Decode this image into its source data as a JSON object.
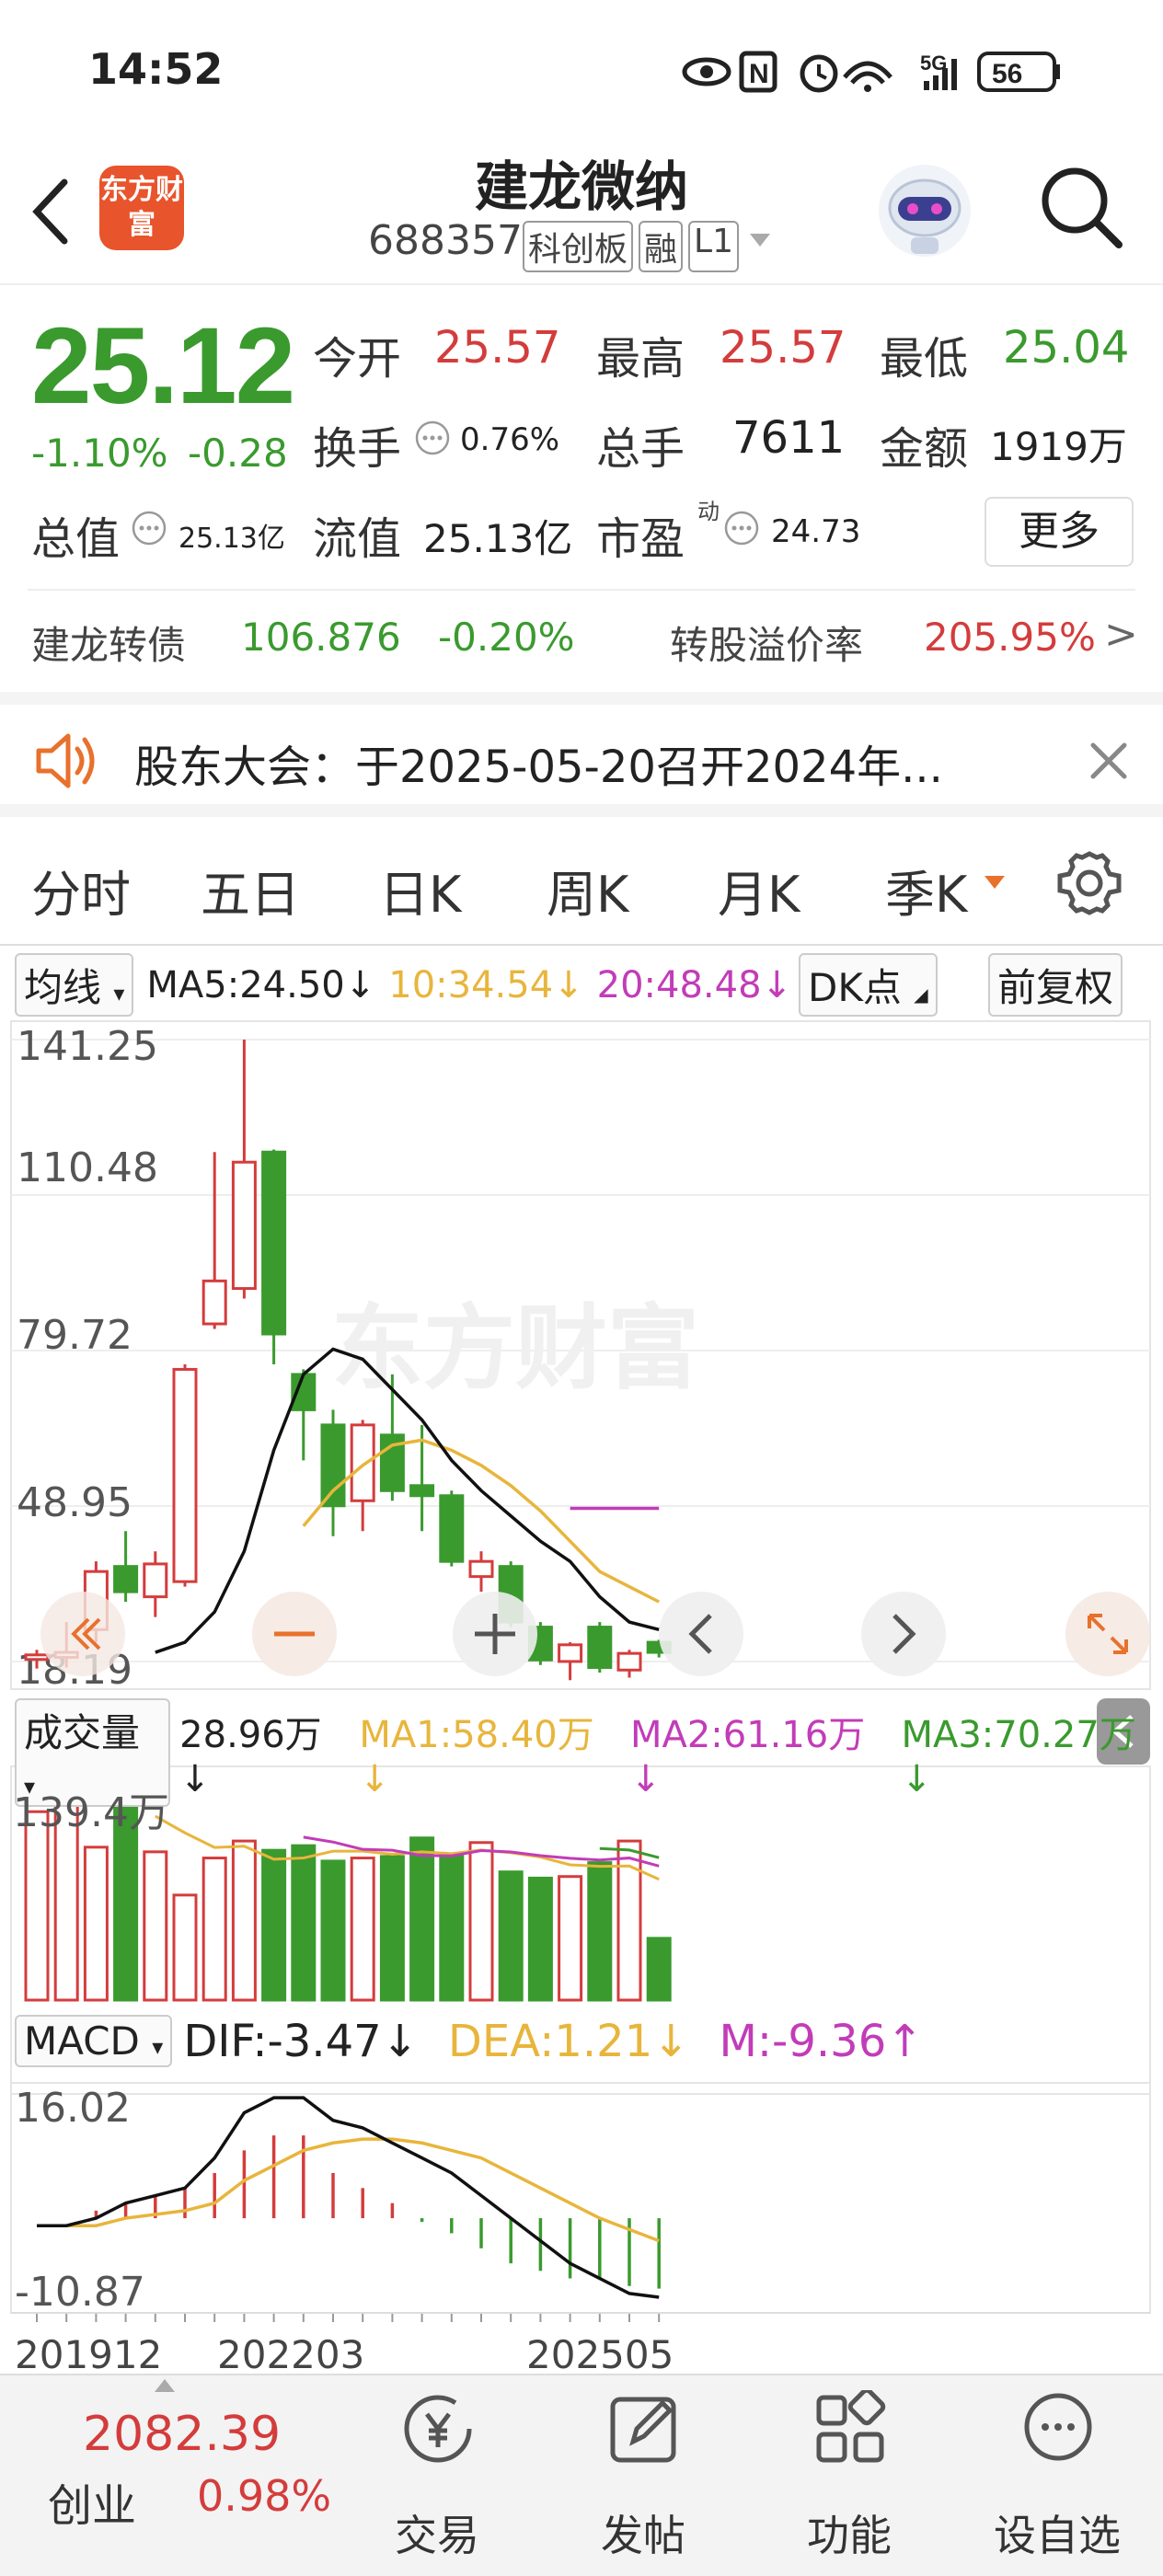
{
  "status": {
    "time": "14:52",
    "network": "5G",
    "battery": "56"
  },
  "header": {
    "logo_text": "东方财富",
    "title": "建龙微纳",
    "code": "688357",
    "tags": [
      "科创板",
      "融",
      "L1"
    ]
  },
  "quote": {
    "price": "25.12",
    "change_pct": "-1.10%",
    "change": "-0.28",
    "open_label": "今开",
    "open": "25.57",
    "high_label": "最高",
    "high": "25.57",
    "low_label": "最低",
    "low": "25.04",
    "turnover_label": "换手",
    "turnover": "0.76%",
    "volume_label": "总手",
    "volume": "7611",
    "amount_label": "金额",
    "amount": "1919万",
    "mktcap_label": "总值",
    "mktcap": "25.13亿",
    "float_label": "流值",
    "float_cap": "25.13亿",
    "pe_label": "市盈",
    "pe_sup": "动",
    "pe": "24.73",
    "more": "更多"
  },
  "bond": {
    "name": "建龙转债",
    "price": "106.876",
    "change": "-0.20%",
    "premium_label": "转股溢价率",
    "premium": "205.95%",
    "arrow": ">"
  },
  "notice": {
    "text": "股东大会：于2025-05-20召开2024年..."
  },
  "tabs": [
    "分时",
    "五日",
    "日K",
    "周K",
    "月K",
    "季K"
  ],
  "active_tab": "季K",
  "ma_bar": {
    "dropdown": "均线",
    "ma5": "MA5:24.50↓",
    "ma10": "10:34.54↓",
    "ma20": "20:48.48↓",
    "dk": "DK点",
    "adjust": "前复权"
  },
  "price_axis": [
    "141.25",
    "110.48",
    "79.72",
    "48.95",
    "18.19"
  ],
  "watermark": "东方财富",
  "vol_bar": {
    "dropdown": "成交量",
    "vol": "28.96万↓",
    "ma1": "MA1:58.40万↓",
    "ma2": "MA2:61.16万↓",
    "ma3": "MA3:70.27万↓",
    "axis_top": "139.4万"
  },
  "macd_bar": {
    "dropdown": "MACD",
    "dif": "DIF:-3.47↓",
    "dea": "DEA:1.21↓",
    "m": "M:-9.36↑",
    "axis_top": "16.02",
    "axis_bottom": "-10.87"
  },
  "date_axis": [
    "201912",
    "202203",
    "202505"
  ],
  "bottom_nav": {
    "index_value": "2082.39",
    "index_name": "创业",
    "index_change": "0.98%",
    "items": [
      "交易",
      "发帖",
      "功能",
      "设自选"
    ]
  },
  "colors": {
    "up": "#d43c3c",
    "down": "#3a9a2e",
    "accent": "#e8712c",
    "ma10": "#e8b53c",
    "ma20": "#c23cb8"
  },
  "chart_data": {
    "type": "candlestick",
    "period": "quarterly",
    "candles": [
      {
        "o": 18.6,
        "c": 19.5,
        "h": 20.5,
        "l": 16.8
      },
      {
        "o": 19.0,
        "c": 20.0,
        "h": 26.0,
        "l": 17.0
      },
      {
        "o": 24.5,
        "c": 36.0,
        "h": 38.0,
        "l": 22.0
      },
      {
        "o": 37.0,
        "c": 32.0,
        "h": 44.0,
        "l": 30.0
      },
      {
        "o": 31.0,
        "c": 37.5,
        "h": 40.0,
        "l": 27.0
      },
      {
        "o": 34.0,
        "c": 76.0,
        "h": 77.0,
        "l": 33.0
      },
      {
        "o": 85.0,
        "c": 93.5,
        "h": 119.0,
        "l": 84.0
      },
      {
        "o": 92.0,
        "c": 117.0,
        "h": 141.25,
        "l": 90.0
      },
      {
        "o": 119.0,
        "c": 83.0,
        "h": 119.5,
        "l": 77.0
      },
      {
        "o": 75.0,
        "c": 68.0,
        "h": 76.0,
        "l": 58.0
      },
      {
        "o": 65.0,
        "c": 49.0,
        "h": 68.0,
        "l": 43.0
      },
      {
        "o": 50.0,
        "c": 65.0,
        "h": 66.0,
        "l": 44.0
      },
      {
        "o": 63.0,
        "c": 52.0,
        "h": 75.0,
        "l": 50.0
      },
      {
        "o": 53.0,
        "c": 51.0,
        "h": 65.0,
        "l": 44.0
      },
      {
        "o": 51.0,
        "c": 38.0,
        "h": 52.0,
        "l": 37.0
      },
      {
        "o": 35.0,
        "c": 38.0,
        "h": 40.0,
        "l": 32.0
      },
      {
        "o": 37.0,
        "c": 26.0,
        "h": 38.0,
        "l": 25.0
      },
      {
        "o": 25.0,
        "c": 18.5,
        "h": 26.0,
        "l": 17.5
      },
      {
        "o": 18.2,
        "c": 21.5,
        "h": 22.0,
        "l": 14.5
      },
      {
        "o": 25.0,
        "c": 17.0,
        "h": 26.0,
        "l": 16.0
      },
      {
        "o": 16.5,
        "c": 19.8,
        "h": 20.5,
        "l": 15.0
      },
      {
        "o": 22.0,
        "c": 20.0,
        "h": 22.5,
        "l": 19.0
      }
    ],
    "volume": [
      122,
      139.4,
      99,
      139,
      96,
      68,
      92,
      103,
      97,
      100,
      90,
      92,
      93,
      105,
      94,
      102,
      83,
      79,
      80,
      89,
      103,
      40
    ],
    "macd_dif": [
      -1,
      -1,
      0,
      2,
      3,
      4,
      8,
      14,
      16,
      16,
      13,
      12,
      10,
      8,
      6,
      3,
      0,
      -3,
      -6,
      -8,
      -10,
      -10.5
    ],
    "macd_dea": [
      -1,
      -1,
      -1,
      0,
      0.5,
      1,
      2,
      5,
      7,
      9,
      10,
      10.5,
      10.5,
      10,
      9,
      8,
      6,
      4,
      2,
      0,
      -1.5,
      -3
    ],
    "macd_m": [
      0,
      0,
      1,
      2,
      3,
      4,
      6,
      9,
      11,
      11,
      6,
      4,
      2,
      -0.5,
      -2,
      -4,
      -6,
      -7,
      -8,
      -8,
      -9,
      -9.36
    ],
    "ma5": [
      null,
      null,
      null,
      null,
      20,
      22,
      28,
      40,
      60,
      75,
      80,
      78,
      72,
      66,
      58,
      52,
      47,
      42,
      38,
      31,
      26,
      24.5
    ],
    "ma10": [
      null,
      null,
      null,
      null,
      null,
      null,
      null,
      null,
      null,
      45,
      52,
      57,
      61,
      62,
      60,
      57,
      53,
      48,
      42,
      36,
      33,
      30
    ],
    "ma20": [
      null,
      null,
      null,
      null,
      null,
      null,
      null,
      null,
      null,
      null,
      null,
      null,
      null,
      null,
      null,
      null,
      null,
      null,
      48.5,
      48.5,
      48.5,
      48.5
    ],
    "price_axis": [
      141.25,
      110.48,
      79.72,
      48.95,
      18.19
    ],
    "volume_axis_top": "139.4万",
    "macd_axis": [
      16.02,
      -10.87
    ],
    "x_labels": [
      "201912",
      "202203",
      "202505"
    ]
  }
}
